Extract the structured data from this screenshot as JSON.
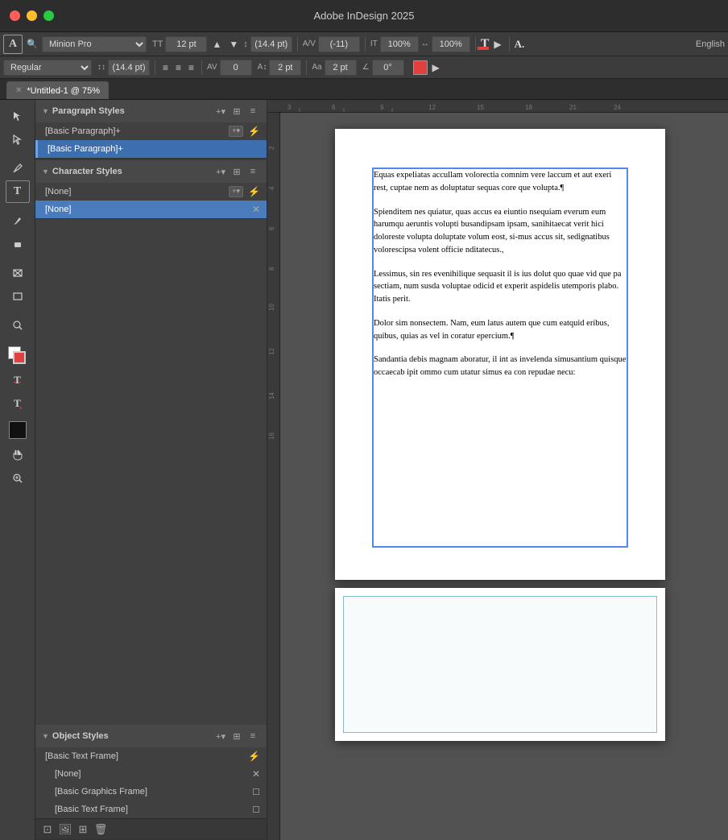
{
  "app": {
    "title": "Adobe InDesign 2025",
    "tab_title": "*Untitled-1 @ 75%",
    "zoom": "75%"
  },
  "toolbar1": {
    "font_family": "Minion Pro",
    "font_style": "Regular",
    "font_size": "12 pt",
    "leading": "(14.4 pt)",
    "tracking": "(-11)",
    "scale_h": "100%",
    "scale_v": "100%",
    "english_label": "English"
  },
  "toolbar2": {
    "kerning": "0",
    "baseline": "2 pt",
    "angle": "0°"
  },
  "paragraph_styles": {
    "title": "Paragraph Styles",
    "items": [
      {
        "label": "[Basic Paragraph]+",
        "selected": false,
        "plus": true
      },
      {
        "label": "[Basic Paragraph]+",
        "selected": true,
        "plus": true
      }
    ]
  },
  "character_styles": {
    "title": "Character Styles",
    "items": [
      {
        "label": "[None]",
        "selected": false
      },
      {
        "label": "[None]",
        "selected": true
      }
    ]
  },
  "object_styles": {
    "title": "Object Styles",
    "items": [
      {
        "label": "[Basic Text Frame]",
        "selected": false,
        "lightning": true
      },
      {
        "label": "[None]",
        "selected": false,
        "close": true
      },
      {
        "label": "[Basic Graphics Frame]",
        "selected": false
      },
      {
        "label": "[Basic Text Frame]",
        "selected": false
      }
    ]
  },
  "document": {
    "paragraphs": [
      "Equas expeliatas accullam volorectia comnim vere laccum et aut exeri rest, cuptae nem as doluptatur sequas core que volupta.¶",
      "Spienditem nes quiatur, quas accus ea eiuntio nsequiam everum eum harumqu aeruntis volupti busandipsam ipsam, sanihitaecat verit hici doloreste volupta doluptate volum eost, si-mus accus sit, sedignatibus volorescipsa volent officie nditatecus.,",
      "Lessimus, sin res evenihilique sequasit il is ius dolut quo quae vid que pa sectiam, num susda voluptae odicid et experit aspidelis utemporis plabo. Itatis perit.",
      "Dolor sim nonsectem. Nam, eum latus autem que cum eatquid eribus, quibus, quias as vel in coratur epercium.¶",
      "Sandantia debis magnam aboratur, il int as invelenda simusantium quisque occaecab ipit ommo cum utatur simus ea con repudae necu:"
    ]
  },
  "icons": {
    "arrow": "▶",
    "hamburger": "≡",
    "plus": "+",
    "lightning": "⚡",
    "close": "✕",
    "add": "⊕",
    "new_style": "📄",
    "delete": "🗑",
    "page": "📄",
    "camera": "📷"
  }
}
